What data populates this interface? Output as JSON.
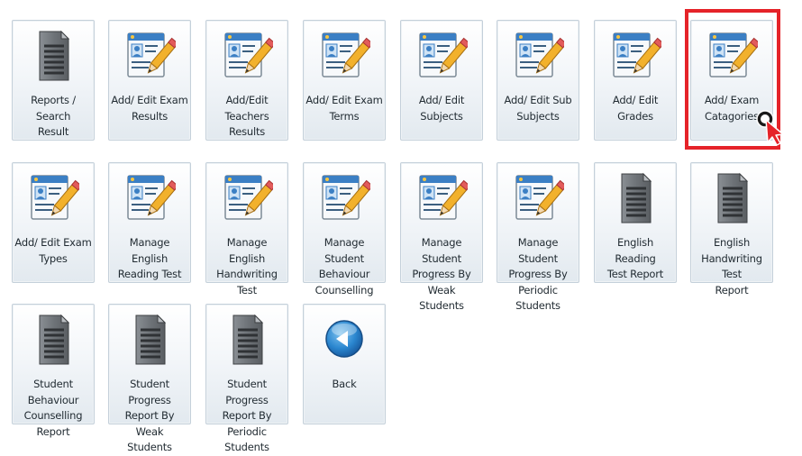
{
  "colors": {
    "highlight": "#e52329",
    "cursor": "#e52329"
  },
  "tiles": [
    {
      "key": "reports-search-result",
      "icon": "document-icon",
      "label": [
        "Reports / Search",
        "Result"
      ]
    },
    {
      "key": "add-edit-exam-results",
      "icon": "edit-form-icon",
      "label": [
        "Add/ Edit Exam",
        "Results"
      ]
    },
    {
      "key": "add-edit-teachers-results",
      "icon": "edit-form-icon",
      "label": [
        "Add/Edit Teachers",
        "Results"
      ]
    },
    {
      "key": "add-edit-exam-terms",
      "icon": "edit-form-icon",
      "label": [
        "Add/ Edit Exam",
        "Terms"
      ]
    },
    {
      "key": "add-edit-subjects",
      "icon": "edit-form-icon",
      "label": [
        "Add/ Edit Subjects"
      ]
    },
    {
      "key": "add-edit-sub-subjects",
      "icon": "edit-form-icon",
      "label": [
        "Add/ Edit Sub",
        "Subjects"
      ]
    },
    {
      "key": "add-edit-grades",
      "icon": "edit-form-icon",
      "label": [
        "Add/ Edit Grades"
      ]
    },
    {
      "key": "add-exam-catagories",
      "icon": "edit-form-icon",
      "label": [
        "Add/ Exam",
        "Catagories"
      ],
      "highlighted": true
    },
    {
      "key": "add-edit-exam-types",
      "icon": "edit-form-icon",
      "label": [
        "Add/ Edit Exam",
        "Types"
      ]
    },
    {
      "key": "manage-english-reading-test",
      "icon": "edit-form-icon",
      "label": [
        "Manage English",
        "Reading Test"
      ]
    },
    {
      "key": "manage-english-handwriting-test",
      "icon": "edit-form-icon",
      "label": [
        "Manage English",
        "Handwriting Test"
      ]
    },
    {
      "key": "manage-student-behaviour-counselling",
      "icon": "edit-form-icon",
      "label": [
        "Manage Student",
        "Behaviour",
        "Counselling"
      ]
    },
    {
      "key": "manage-student-progress-weak",
      "icon": "edit-form-icon",
      "label": [
        "Manage Student",
        "Progress By Weak",
        "Students"
      ]
    },
    {
      "key": "manage-student-progress-periodic",
      "icon": "edit-form-icon",
      "label": [
        "Manage Student",
        "Progress By",
        "Periodic Students"
      ]
    },
    {
      "key": "english-reading-test-report",
      "icon": "document-icon",
      "label": [
        "English Reading",
        "Test Report"
      ]
    },
    {
      "key": "english-handwriting-test-report",
      "icon": "document-icon",
      "label": [
        "English",
        "Handwriting Test",
        "Report"
      ]
    },
    {
      "key": "student-behaviour-counselling-report",
      "icon": "document-icon",
      "label": [
        "Student Behaviour",
        "Counselling",
        "Report"
      ]
    },
    {
      "key": "student-progress-report-weak",
      "icon": "document-icon",
      "label": [
        "Student Progress",
        "Report By Weak",
        "Students"
      ]
    },
    {
      "key": "student-progress-report-periodic",
      "icon": "document-icon",
      "label": [
        "Student Progress",
        "Report By Periodic",
        "Students"
      ]
    },
    {
      "key": "back",
      "icon": "back-arrow-icon",
      "label": [
        "Back"
      ]
    }
  ]
}
